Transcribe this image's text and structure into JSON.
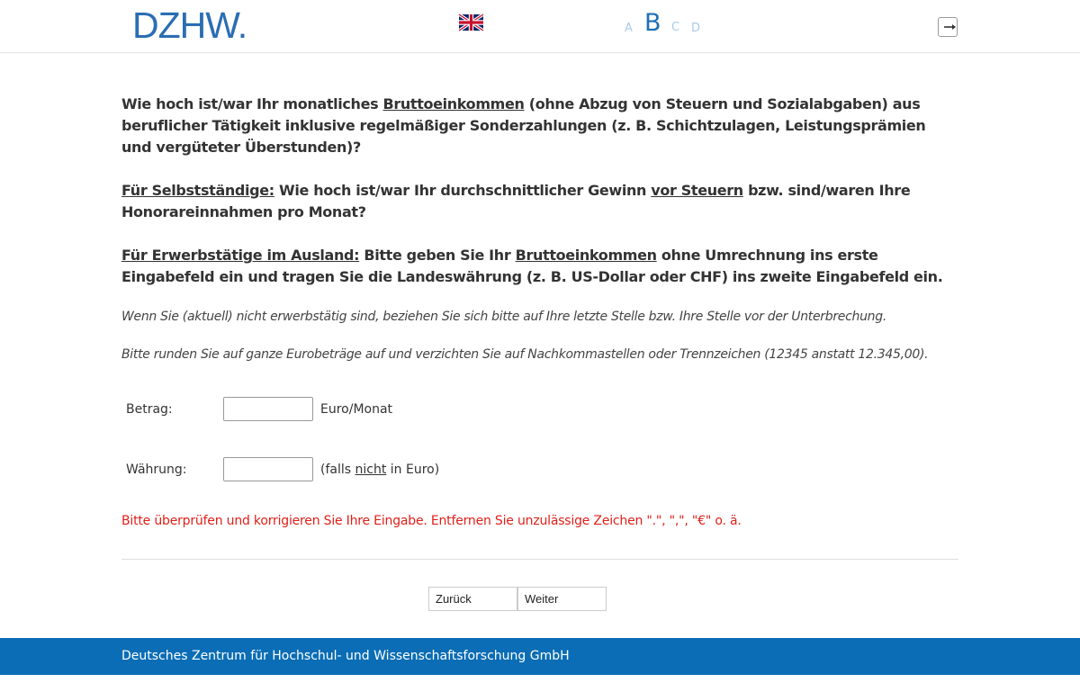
{
  "header": {
    "logo": "DZHW.",
    "language_icon": "uk-flag-icon",
    "progress": [
      {
        "label": "A",
        "current": false
      },
      {
        "label": "B",
        "current": true
      },
      {
        "label": "C",
        "current": false
      },
      {
        "label": "D",
        "current": false
      }
    ],
    "logout_icon": "logout-icon"
  },
  "question": {
    "p1_a": "Wie hoch ist/war Ihr monatliches ",
    "p1_u": "Bruttoeinkommen",
    "p1_b": " (ohne Abzug von Steuern und Sozialabgaben) aus beruflicher Tätigkeit inklusive regelmäßiger Sonderzahlungen (z. B. Schichtzulagen, Leistungsprämien und vergüteter Überstunden)?",
    "p2_u": "Für Selbstständige:",
    "p2_a": " Wie hoch ist/war Ihr durchschnittlicher Gewinn ",
    "p2_u2": "vor Steuern",
    "p2_b": " bzw. sind/waren Ihre Honorareinnahmen pro Monat?",
    "p3_u": "Für Erwerbstätige im Ausland:",
    "p3_a": " Bitte geben Sie Ihr ",
    "p3_u2": "Bruttoeinkommen",
    "p3_b": " ohne Umrechnung ins erste Eingabefeld ein und tragen Sie die Landeswährung (z. B. US-Dollar oder CHF) ins zweite Eingabefeld ein.",
    "note1": "Wenn Sie (aktuell) nicht erwerbstätig sind, beziehen Sie sich bitte auf Ihre letzte Stelle bzw. Ihre Stelle vor der Unterbrechung.",
    "note2": "Bitte runden Sie auf ganze Eurobeträge auf und verzichten Sie auf Nachkommastellen oder Trennzeichen (12345 anstatt 12.345,00)."
  },
  "fields": {
    "amount_label": "Betrag:",
    "amount_value": "",
    "amount_unit": "Euro/Monat",
    "currency_label": "Währung:",
    "currency_value": "",
    "currency_unit_a": "(falls ",
    "currency_unit_u": "nicht",
    "currency_unit_b": " in Euro)"
  },
  "error": "Bitte überprüfen und korrigieren Sie Ihre Eingabe. Entfernen Sie unzulässige Zeichen \".\", \",\", \"€\" o. ä.",
  "nav": {
    "back": "Zurück",
    "next": "Weiter"
  },
  "footer": "Deutsches Zentrum für Hochschul- und Wissenschaftsforschung GmbH",
  "colors": {
    "brand": "#0a6db5",
    "error": "#e0201a",
    "progress_inactive": "#a9cbe8"
  }
}
